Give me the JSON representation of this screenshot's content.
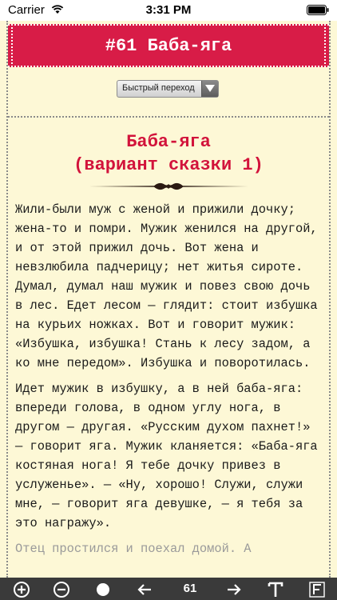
{
  "status_bar": {
    "carrier": "Carrier",
    "time": "3:31 PM"
  },
  "header": {
    "title": "#61 Баба-яга",
    "bg_color": "#d81c47"
  },
  "quick_jump": {
    "label": "Быстрый переход"
  },
  "story": {
    "title_line1": "Баба-яга",
    "title_line2": "(вариант сказки 1)",
    "title_color": "#d2133b",
    "paragraphs": [
      "Жили-были муж с женой и прижили дочку; жена-то и помри. Мужик женился на другой, и от этой прижил дочь. Вот жена и невзлюбила падчерицу; нет житья сироте. Думал, думал наш мужик и повез свою дочь в лес. Едет лесом — глядит: стоит избушка на курьих ножках. Вот и говорит мужик: «Избушка, избушка! Стань к лесу задом, а ко мне передом». Избушка и поворотилась.",
      "Идет мужик в избушку, а в ней баба-яга: впереди голова, в одном углу нога, в другом — другая. «Русским духом пахнет!» — говорит яга. Мужик кланяется: «Баба-яга костяная нога! Я тебе дочку привез в услуженье». — «Ну, хорошо! Служи, служи мне, — говорит яга девушке, — я тебя за это награжу»."
    ],
    "partial_line": "Отец простился и поехал домой. А"
  },
  "toolbar": {
    "page_number": "61",
    "items": [
      "zoom-in-icon",
      "zoom-out-icon",
      "night-mode-icon",
      "back-icon",
      "forward-icon",
      "font-icon",
      "font-style-icon"
    ]
  }
}
